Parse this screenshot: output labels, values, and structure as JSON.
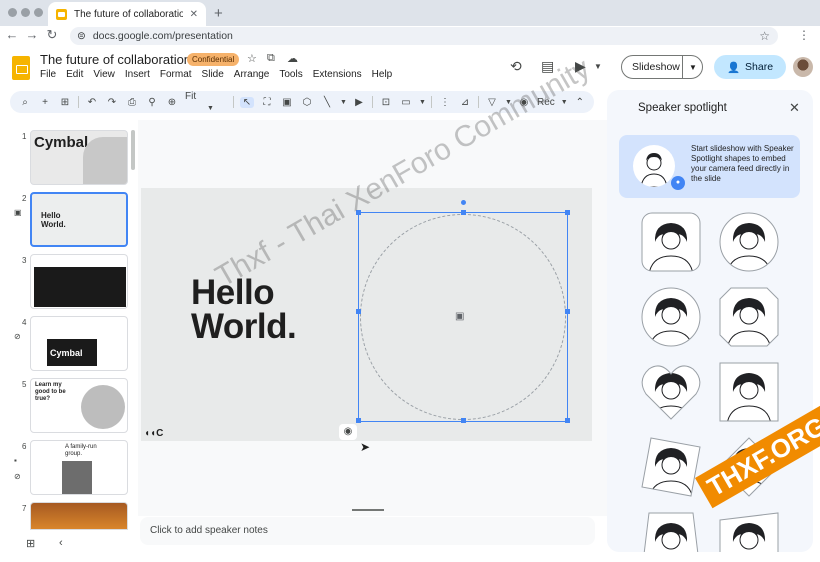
{
  "browser": {
    "tab_title": "The future of collaboration",
    "tab_close": "✕",
    "new_tab": "+",
    "url": "docs.google.com/presentation",
    "icons": [
      "back-arrow-icon",
      "forward-arrow-icon",
      "reload-icon",
      "bookmark-star-icon",
      "more-vert-icon"
    ]
  },
  "header": {
    "doc_title": "The future of collaboration",
    "badge": "Confidential",
    "badge_color": "#f6b26b",
    "menus": [
      "File",
      "Edit",
      "View",
      "Insert",
      "Format",
      "Slide",
      "Arrange",
      "Tools",
      "Extensions",
      "Help"
    ],
    "slideshow_label": "Slideshow",
    "share_label": "Share",
    "share_color": "#c2e7ff"
  },
  "toolbar": {
    "zoom_label": "Fit",
    "rec_label": "Rec",
    "icons": [
      "search-icon",
      "add-icon",
      "new-slide-icon",
      "undo-icon",
      "redo-icon",
      "print-icon",
      "paint-format-icon",
      "zoom-icon",
      "select-icon",
      "frame-icon",
      "image-icon",
      "shapes-icon",
      "line-icon",
      "video-icon",
      "comment-icon",
      "layout-icon",
      "more-icon",
      "background-icon",
      "motion-icon",
      "record-icon",
      "collapse-icon"
    ]
  },
  "filmstrip": {
    "slides": [
      {
        "num": "1",
        "title": "Cymbal"
      },
      {
        "num": "2",
        "title": "Hello World."
      },
      {
        "num": "3",
        "title": ""
      },
      {
        "num": "4",
        "title": "Cymbal"
      },
      {
        "num": "5",
        "title": "Learn my good to be true?"
      },
      {
        "num": "6",
        "title": "A family-run group."
      },
      {
        "num": "7",
        "title": ""
      }
    ]
  },
  "slide": {
    "title_line1": "Hello",
    "title_line2": "World.",
    "logo": "◖◖C"
  },
  "notes": {
    "placeholder": "Click to add speaker notes"
  },
  "panel": {
    "title": "Speaker spotlight",
    "close": "✕",
    "info": "Start slideshow with Speaker Spotlight shapes to embed your camera feed directly in the slide",
    "accent_color": "#d3e3fd"
  },
  "watermark": {
    "text": "Thxf - Thai XenForo Community",
    "logo_text": "THXF.ORG"
  }
}
